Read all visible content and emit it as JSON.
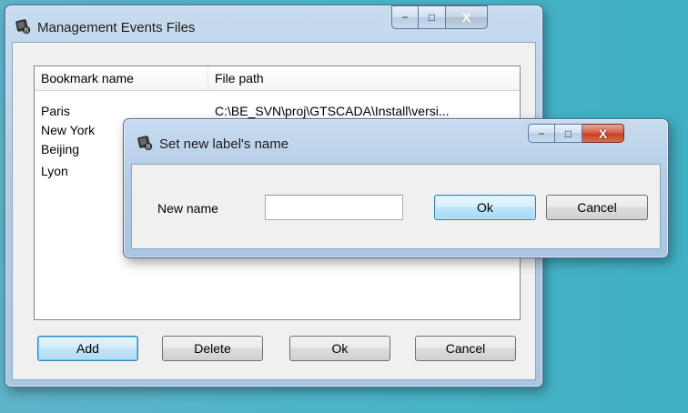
{
  "main_window": {
    "title": "Management Events Files",
    "controls": {
      "minimize": "−",
      "maximize": "□",
      "close": "X"
    },
    "columns": [
      "Bookmark name",
      "File path"
    ],
    "rows": [
      {
        "name": "Paris",
        "path": "C:\\BE_SVN\\proj\\GTSCADA\\Install\\versi..."
      },
      {
        "name": "New York",
        "path": ""
      },
      {
        "name": "Beijing",
        "path": ""
      },
      {
        "name": "Lyon",
        "path": ""
      }
    ],
    "buttons": {
      "add": "Add",
      "delete": "Delete",
      "ok": "Ok",
      "cancel": "Cancel"
    }
  },
  "dialog": {
    "title": "Set new label's name",
    "controls": {
      "minimize": "−",
      "maximize": "□",
      "close": "X"
    },
    "field_label": "New name",
    "field_value": "",
    "buttons": {
      "ok": "Ok",
      "cancel": "Cancel"
    }
  }
}
